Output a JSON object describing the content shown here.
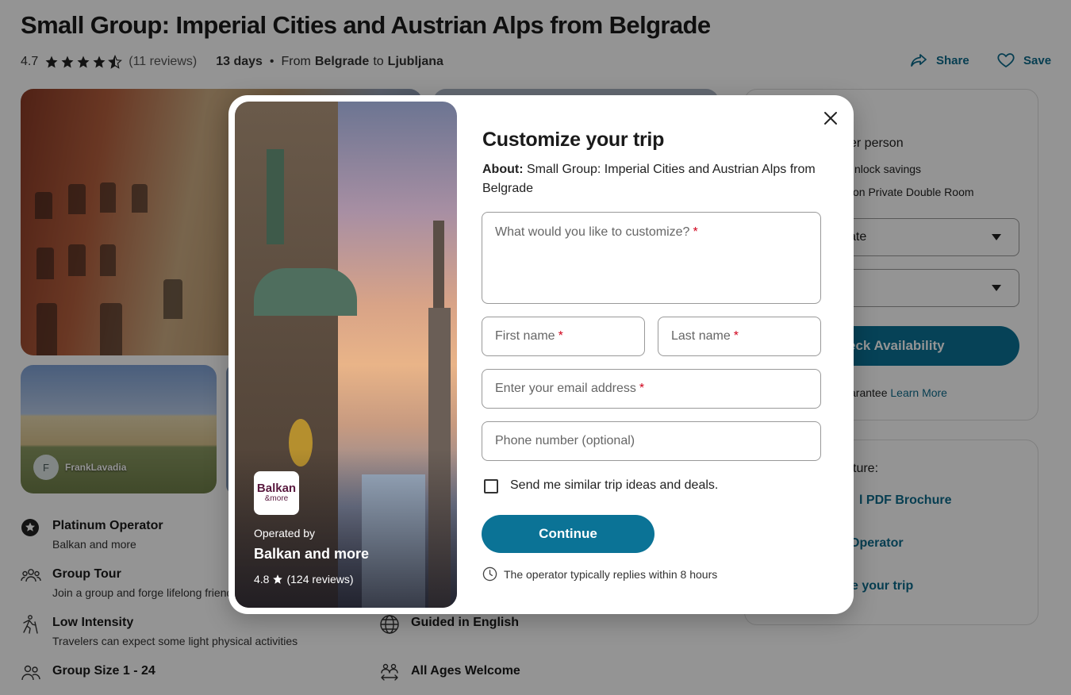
{
  "page": {
    "title": "Small Group: Imperial Cities and Austrian Alps from Belgrade",
    "rating": "4.7",
    "reviews": "(11 reviews)",
    "days": "13 days",
    "dot": "•",
    "from_label": "From",
    "from_city": "Belgrade",
    "to_label": "to",
    "to_city": "Ljubljana",
    "share_label": "Share",
    "save_label": "Save",
    "thumb_avatar_initial": "F",
    "thumb_user": "FrankLavadia"
  },
  "features": [
    {
      "title": "Platinum Operator",
      "sub": "Balkan and more",
      "icon": "star-badge-icon"
    },
    {
      "title": "Group Tour",
      "sub": "Join a group and forge lifelong friend",
      "icon": "group-icon"
    },
    {
      "title": "Low Intensity",
      "sub": "Travelers can expect some light physical activities",
      "icon": "hiker-icon"
    },
    {
      "title": "Group Size 1 - 24",
      "sub": "",
      "icon": "people-icon"
    },
    {
      "title": "Guided in English",
      "sub": "",
      "icon": "globe-icon"
    },
    {
      "title": "All Ages Welcome",
      "sub": "",
      "icon": "ages-icon"
    }
  ],
  "sidebar": {
    "per_person": "er person",
    "unlock": "nlock savings",
    "room": "on Private Double Room",
    "select_date": "ate",
    "select_travelers": "",
    "check_btn": "eck Availability",
    "guarantee": "arantee",
    "learn_more": "Learn More",
    "feature_text": "ture:",
    "pdf_link": "l PDF Brochure",
    "operator_link": "Operator",
    "customize_link": "e your trip"
  },
  "modal": {
    "title": "Customize your trip",
    "about_label": "About:",
    "about_text": "Small Group: Imperial Cities and Austrian Alps from Belgrade",
    "customize_placeholder": "What would you like to customize?",
    "first_name_placeholder": "First name",
    "last_name_placeholder": "Last name",
    "email_placeholder": "Enter your email address",
    "phone_placeholder": "Phone number (optional)",
    "required_mark": "*",
    "checkbox_label": "Send me similar trip ideas and deals.",
    "continue_label": "Continue",
    "reply_note": "The operator typically replies within 8 hours",
    "operator": {
      "logo_text": "Balkan",
      "logo_sub": "&more",
      "operated_by": "Operated by",
      "name": "Balkan and more",
      "rating": "4.8",
      "reviews": "(124 reviews)"
    }
  },
  "colors": {
    "accent": "#0b7396",
    "link": "#0d6b8c",
    "required": "#d0021b",
    "overlay": "rgba(0,0,0,0.42)"
  }
}
